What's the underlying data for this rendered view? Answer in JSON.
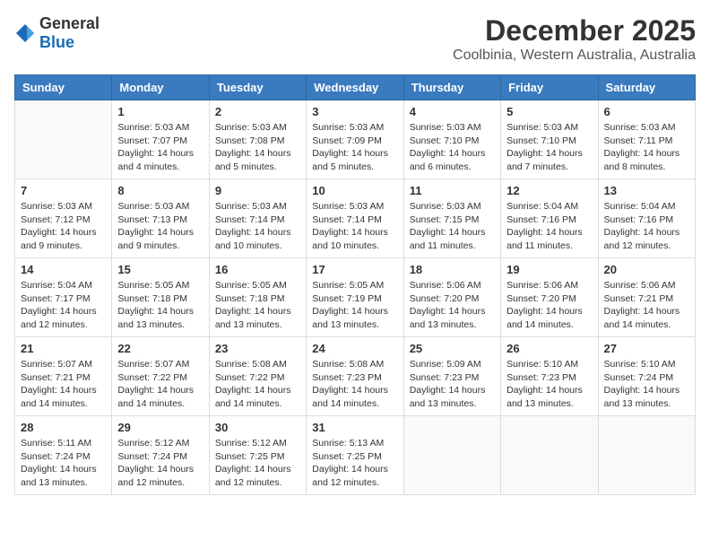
{
  "logo": {
    "general": "General",
    "blue": "Blue"
  },
  "header": {
    "month": "December 2025",
    "location": "Coolbinia, Western Australia, Australia"
  },
  "weekdays": [
    "Sunday",
    "Monday",
    "Tuesday",
    "Wednesday",
    "Thursday",
    "Friday",
    "Saturday"
  ],
  "weeks": [
    [
      {
        "day": "",
        "sunrise": "",
        "sunset": "",
        "daylight": ""
      },
      {
        "day": "1",
        "sunrise": "Sunrise: 5:03 AM",
        "sunset": "Sunset: 7:07 PM",
        "daylight": "Daylight: 14 hours and 4 minutes."
      },
      {
        "day": "2",
        "sunrise": "Sunrise: 5:03 AM",
        "sunset": "Sunset: 7:08 PM",
        "daylight": "Daylight: 14 hours and 5 minutes."
      },
      {
        "day": "3",
        "sunrise": "Sunrise: 5:03 AM",
        "sunset": "Sunset: 7:09 PM",
        "daylight": "Daylight: 14 hours and 5 minutes."
      },
      {
        "day": "4",
        "sunrise": "Sunrise: 5:03 AM",
        "sunset": "Sunset: 7:10 PM",
        "daylight": "Daylight: 14 hours and 6 minutes."
      },
      {
        "day": "5",
        "sunrise": "Sunrise: 5:03 AM",
        "sunset": "Sunset: 7:10 PM",
        "daylight": "Daylight: 14 hours and 7 minutes."
      },
      {
        "day": "6",
        "sunrise": "Sunrise: 5:03 AM",
        "sunset": "Sunset: 7:11 PM",
        "daylight": "Daylight: 14 hours and 8 minutes."
      }
    ],
    [
      {
        "day": "7",
        "sunrise": "Sunrise: 5:03 AM",
        "sunset": "Sunset: 7:12 PM",
        "daylight": "Daylight: 14 hours and 9 minutes."
      },
      {
        "day": "8",
        "sunrise": "Sunrise: 5:03 AM",
        "sunset": "Sunset: 7:13 PM",
        "daylight": "Daylight: 14 hours and 9 minutes."
      },
      {
        "day": "9",
        "sunrise": "Sunrise: 5:03 AM",
        "sunset": "Sunset: 7:14 PM",
        "daylight": "Daylight: 14 hours and 10 minutes."
      },
      {
        "day": "10",
        "sunrise": "Sunrise: 5:03 AM",
        "sunset": "Sunset: 7:14 PM",
        "daylight": "Daylight: 14 hours and 10 minutes."
      },
      {
        "day": "11",
        "sunrise": "Sunrise: 5:03 AM",
        "sunset": "Sunset: 7:15 PM",
        "daylight": "Daylight: 14 hours and 11 minutes."
      },
      {
        "day": "12",
        "sunrise": "Sunrise: 5:04 AM",
        "sunset": "Sunset: 7:16 PM",
        "daylight": "Daylight: 14 hours and 11 minutes."
      },
      {
        "day": "13",
        "sunrise": "Sunrise: 5:04 AM",
        "sunset": "Sunset: 7:16 PM",
        "daylight": "Daylight: 14 hours and 12 minutes."
      }
    ],
    [
      {
        "day": "14",
        "sunrise": "Sunrise: 5:04 AM",
        "sunset": "Sunset: 7:17 PM",
        "daylight": "Daylight: 14 hours and 12 minutes."
      },
      {
        "day": "15",
        "sunrise": "Sunrise: 5:05 AM",
        "sunset": "Sunset: 7:18 PM",
        "daylight": "Daylight: 14 hours and 13 minutes."
      },
      {
        "day": "16",
        "sunrise": "Sunrise: 5:05 AM",
        "sunset": "Sunset: 7:18 PM",
        "daylight": "Daylight: 14 hours and 13 minutes."
      },
      {
        "day": "17",
        "sunrise": "Sunrise: 5:05 AM",
        "sunset": "Sunset: 7:19 PM",
        "daylight": "Daylight: 14 hours and 13 minutes."
      },
      {
        "day": "18",
        "sunrise": "Sunrise: 5:06 AM",
        "sunset": "Sunset: 7:20 PM",
        "daylight": "Daylight: 14 hours and 13 minutes."
      },
      {
        "day": "19",
        "sunrise": "Sunrise: 5:06 AM",
        "sunset": "Sunset: 7:20 PM",
        "daylight": "Daylight: 14 hours and 14 minutes."
      },
      {
        "day": "20",
        "sunrise": "Sunrise: 5:06 AM",
        "sunset": "Sunset: 7:21 PM",
        "daylight": "Daylight: 14 hours and 14 minutes."
      }
    ],
    [
      {
        "day": "21",
        "sunrise": "Sunrise: 5:07 AM",
        "sunset": "Sunset: 7:21 PM",
        "daylight": "Daylight: 14 hours and 14 minutes."
      },
      {
        "day": "22",
        "sunrise": "Sunrise: 5:07 AM",
        "sunset": "Sunset: 7:22 PM",
        "daylight": "Daylight: 14 hours and 14 minutes."
      },
      {
        "day": "23",
        "sunrise": "Sunrise: 5:08 AM",
        "sunset": "Sunset: 7:22 PM",
        "daylight": "Daylight: 14 hours and 14 minutes."
      },
      {
        "day": "24",
        "sunrise": "Sunrise: 5:08 AM",
        "sunset": "Sunset: 7:23 PM",
        "daylight": "Daylight: 14 hours and 14 minutes."
      },
      {
        "day": "25",
        "sunrise": "Sunrise: 5:09 AM",
        "sunset": "Sunset: 7:23 PM",
        "daylight": "Daylight: 14 hours and 13 minutes."
      },
      {
        "day": "26",
        "sunrise": "Sunrise: 5:10 AM",
        "sunset": "Sunset: 7:23 PM",
        "daylight": "Daylight: 14 hours and 13 minutes."
      },
      {
        "day": "27",
        "sunrise": "Sunrise: 5:10 AM",
        "sunset": "Sunset: 7:24 PM",
        "daylight": "Daylight: 14 hours and 13 minutes."
      }
    ],
    [
      {
        "day": "28",
        "sunrise": "Sunrise: 5:11 AM",
        "sunset": "Sunset: 7:24 PM",
        "daylight": "Daylight: 14 hours and 13 minutes."
      },
      {
        "day": "29",
        "sunrise": "Sunrise: 5:12 AM",
        "sunset": "Sunset: 7:24 PM",
        "daylight": "Daylight: 14 hours and 12 minutes."
      },
      {
        "day": "30",
        "sunrise": "Sunrise: 5:12 AM",
        "sunset": "Sunset: 7:25 PM",
        "daylight": "Daylight: 14 hours and 12 minutes."
      },
      {
        "day": "31",
        "sunrise": "Sunrise: 5:13 AM",
        "sunset": "Sunset: 7:25 PM",
        "daylight": "Daylight: 14 hours and 12 minutes."
      },
      {
        "day": "",
        "sunrise": "",
        "sunset": "",
        "daylight": ""
      },
      {
        "day": "",
        "sunrise": "",
        "sunset": "",
        "daylight": ""
      },
      {
        "day": "",
        "sunrise": "",
        "sunset": "",
        "daylight": ""
      }
    ]
  ]
}
